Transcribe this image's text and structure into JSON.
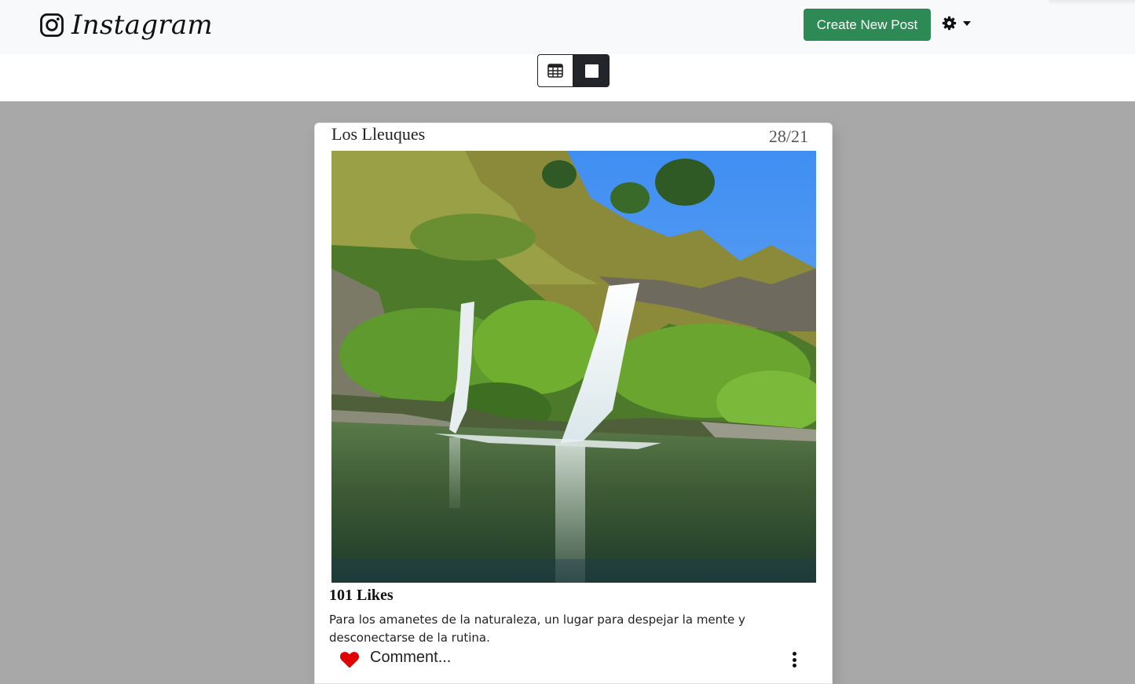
{
  "navbar": {
    "brand": {
      "icon": "instagram-icon",
      "text": "Instagram"
    },
    "create_button_label": "Create New Post",
    "settings": {
      "icon": "gear-icon",
      "caret_icon": "caret-down-icon"
    },
    "create_button_color": "#2e8a54"
  },
  "view_toggle": {
    "grid_icon": "table-grid-icon",
    "single_icon": "single-square-icon",
    "active": "single"
  },
  "post": {
    "title": "Los Lleuques",
    "date": "28/21",
    "image": "waterfall-photo",
    "likes": "101 Likes",
    "caption": "Para los amanetes de la naturaleza, un lugar para despejar la mente y desconectarse de la rutina.",
    "comment_placeholder": "Comment...",
    "like_icon": "heart-icon",
    "like_color": "#e00000",
    "more_icon": "kebab-menu-icon"
  }
}
